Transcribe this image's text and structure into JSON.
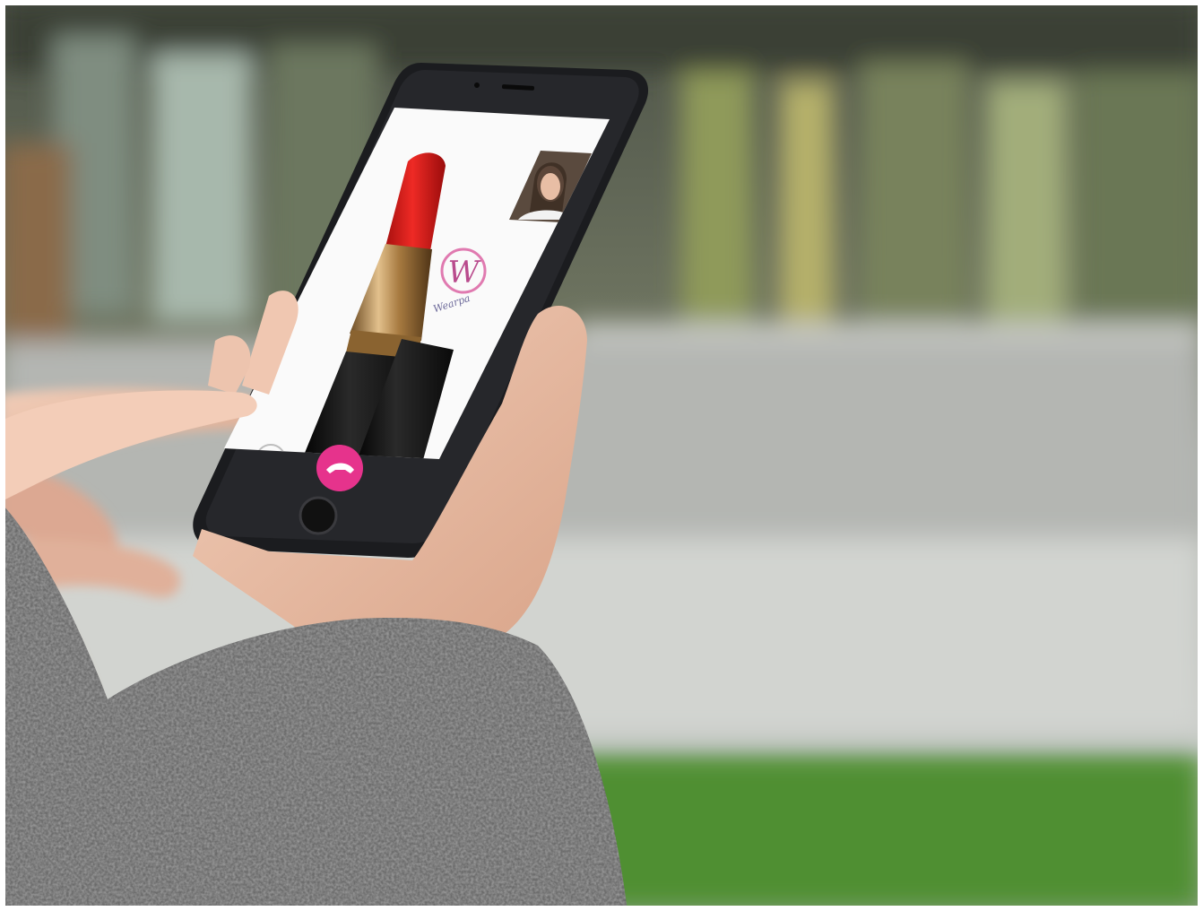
{
  "scene": {
    "description_id": "photo",
    "colors": {
      "background_top": "#5d6458",
      "background_mid": "#9ea3a0",
      "grass": "#5a9a3c",
      "phone_body": "#1b1c1f",
      "screen": "#ffffff",
      "lipstick": "#e01a1c",
      "gold": "#b8894a",
      "call_button": "#e6338c",
      "logo": "#d94c98",
      "sweater": "#6a6a6a",
      "skin": "#e8b9a2"
    },
    "app": {
      "logo_text": "W",
      "logo_script": "Wearpa",
      "call_icon": "phone-hangup-icon"
    }
  }
}
